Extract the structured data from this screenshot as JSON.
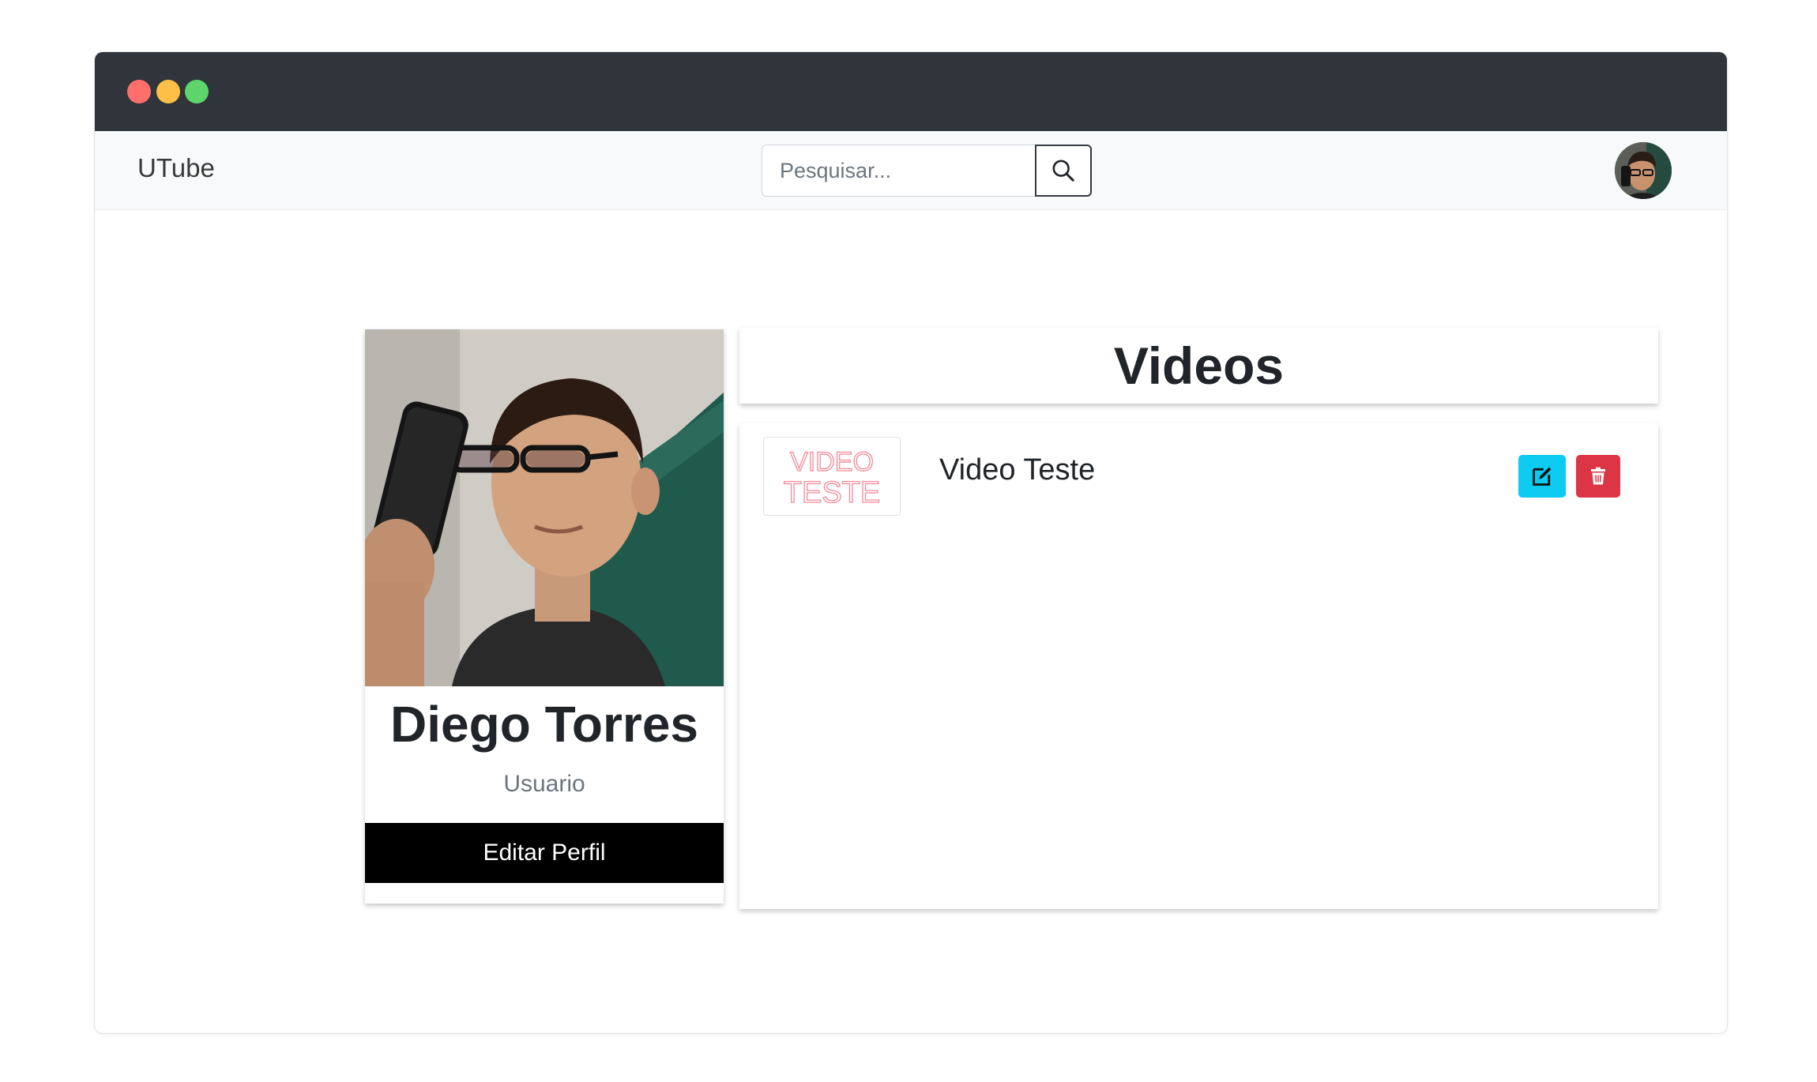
{
  "navbar": {
    "brand": "UTube",
    "search_placeholder": "Pesquisar...",
    "search_value": ""
  },
  "profile": {
    "name": "Diego Torres",
    "role": "Usuario",
    "edit_button_label": "Editar Perfil"
  },
  "videos": {
    "title": "Videos",
    "items": [
      {
        "title": "Video Teste",
        "thumbnail_text": [
          "VIDEO",
          "TESTE"
        ]
      }
    ]
  },
  "icons": {
    "search": "search-icon",
    "edit": "edit-icon",
    "delete": "trash-icon"
  },
  "colors": {
    "titlebar": "#2f353b",
    "navbar_bg": "#f8f9fa",
    "edit_button": "#0dcaf0",
    "delete_button": "#dc3545",
    "profile_button": "#000000",
    "thumbnail_text": "#f28a9a"
  }
}
